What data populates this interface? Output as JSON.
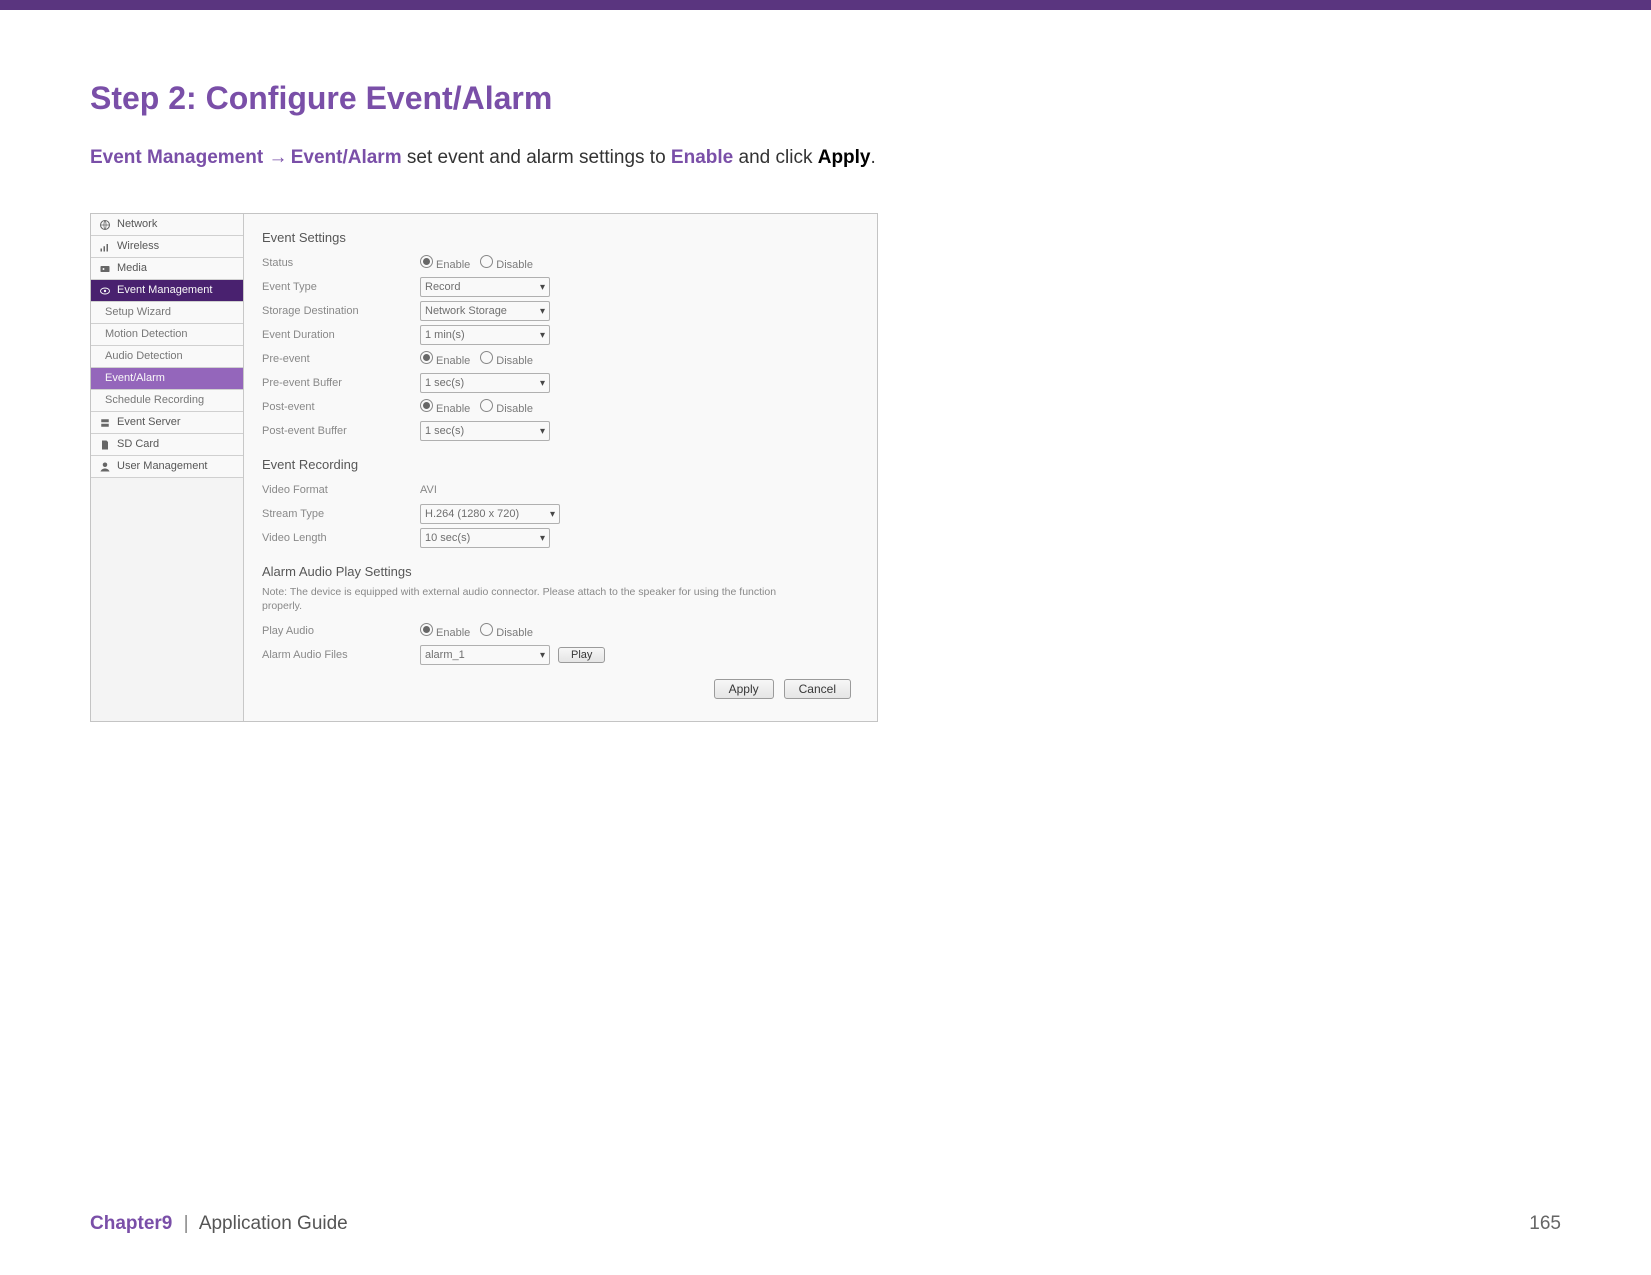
{
  "doc": {
    "step_title": "Step 2: Configure Event/Alarm",
    "instr": {
      "kw1": "Event Management",
      "kw2": "Event/Alarm",
      "mid": " set event and alarm settings to ",
      "kw3": "Enable",
      "mid2": " and click ",
      "bold": "Apply",
      "end": "."
    },
    "footer": {
      "chapter": "Chapter9",
      "separator": "|",
      "guide": "Application Guide",
      "page": "165"
    }
  },
  "sidebar": {
    "items": [
      {
        "name": "network",
        "label": "Network",
        "icon": "globe"
      },
      {
        "name": "wireless",
        "label": "Wireless",
        "icon": "signal"
      },
      {
        "name": "media",
        "label": "Media",
        "icon": "media"
      },
      {
        "name": "event-mgmt",
        "label": "Event Management",
        "icon": "eye",
        "selected": true
      },
      {
        "name": "setup-wizard",
        "label": "Setup Wizard",
        "sub": true
      },
      {
        "name": "motion-detection",
        "label": "Motion Detection",
        "sub": true
      },
      {
        "name": "audio-detection",
        "label": "Audio Detection",
        "sub": true
      },
      {
        "name": "event-alarm",
        "label": "Event/Alarm",
        "sub": true,
        "active": true
      },
      {
        "name": "schedule-recording",
        "label": "Schedule Recording",
        "sub": true
      },
      {
        "name": "event-server",
        "label": "Event Server",
        "icon": "server"
      },
      {
        "name": "sd-card",
        "label": "SD Card",
        "icon": "sdcard"
      },
      {
        "name": "user-mgmt",
        "label": "User Management",
        "icon": "user"
      }
    ]
  },
  "event_settings": {
    "heading": "Event Settings",
    "status_label": "Status",
    "status_value": "Enable",
    "event_type_label": "Event Type",
    "event_type_value": "Record",
    "storage_dest_label": "Storage Destination",
    "storage_dest_value": "Network Storage",
    "event_duration_label": "Event Duration",
    "event_duration_value": "1 min(s)",
    "pre_event_label": "Pre-event",
    "pre_event_value": "Enable",
    "pre_event_buffer_label": "Pre-event Buffer",
    "pre_event_buffer_value": "1 sec(s)",
    "post_event_label": "Post-event",
    "post_event_value": "Enable",
    "post_event_buffer_label": "Post-event Buffer",
    "post_event_buffer_value": "1 sec(s)"
  },
  "event_recording": {
    "heading": "Event Recording",
    "video_format_label": "Video Format",
    "video_format_value": "AVI",
    "stream_type_label": "Stream Type",
    "stream_type_value": "H.264 (1280 x 720)",
    "video_length_label": "Video Length",
    "video_length_value": "10 sec(s)"
  },
  "alarm_audio": {
    "heading": "Alarm Audio Play Settings",
    "note": "Note: The device is equipped with external audio connector. Please attach to the speaker for using the function properly.",
    "play_audio_label": "Play Audio",
    "play_audio_value": "Enable",
    "files_label": "Alarm Audio Files",
    "files_value": "alarm_1",
    "play_button": "Play"
  },
  "buttons": {
    "apply": "Apply",
    "cancel": "Cancel"
  },
  "radio_labels": {
    "enable": "Enable",
    "disable": "Disable"
  }
}
